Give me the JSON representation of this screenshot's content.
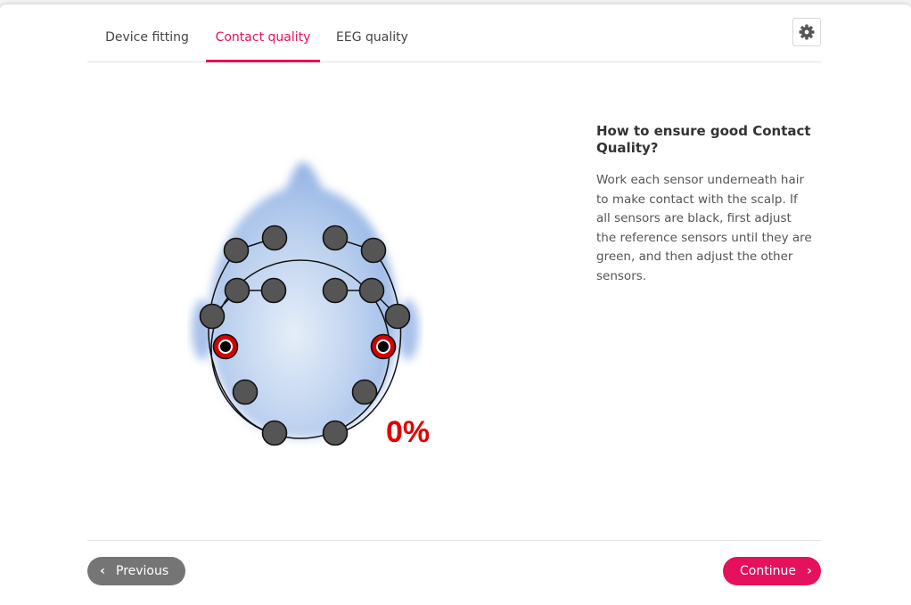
{
  "tabs": [
    {
      "label": "Device fitting"
    },
    {
      "label": "Contact quality",
      "active": true
    },
    {
      "label": "EEG quality"
    }
  ],
  "settings": {
    "icon": "gear-icon"
  },
  "contact": {
    "percent_label": "0%",
    "percent_value": 0,
    "sensor_states": {
      "reference": "red",
      "others": "black"
    }
  },
  "help": {
    "title": "How to ensure good Contact Quality?",
    "body": "Work each sensor underneath hair to make contact with the scalp. If all sensors are black, first adjust the reference sensors until they are green, and then adjust the other sensors."
  },
  "footer": {
    "previous_label": "Previous",
    "continue_label": "Continue"
  },
  "colors": {
    "accent": "#e5115c",
    "percent": "#e00000",
    "sensor_inactive": "#555555",
    "sensor_reference": "#d40000"
  }
}
